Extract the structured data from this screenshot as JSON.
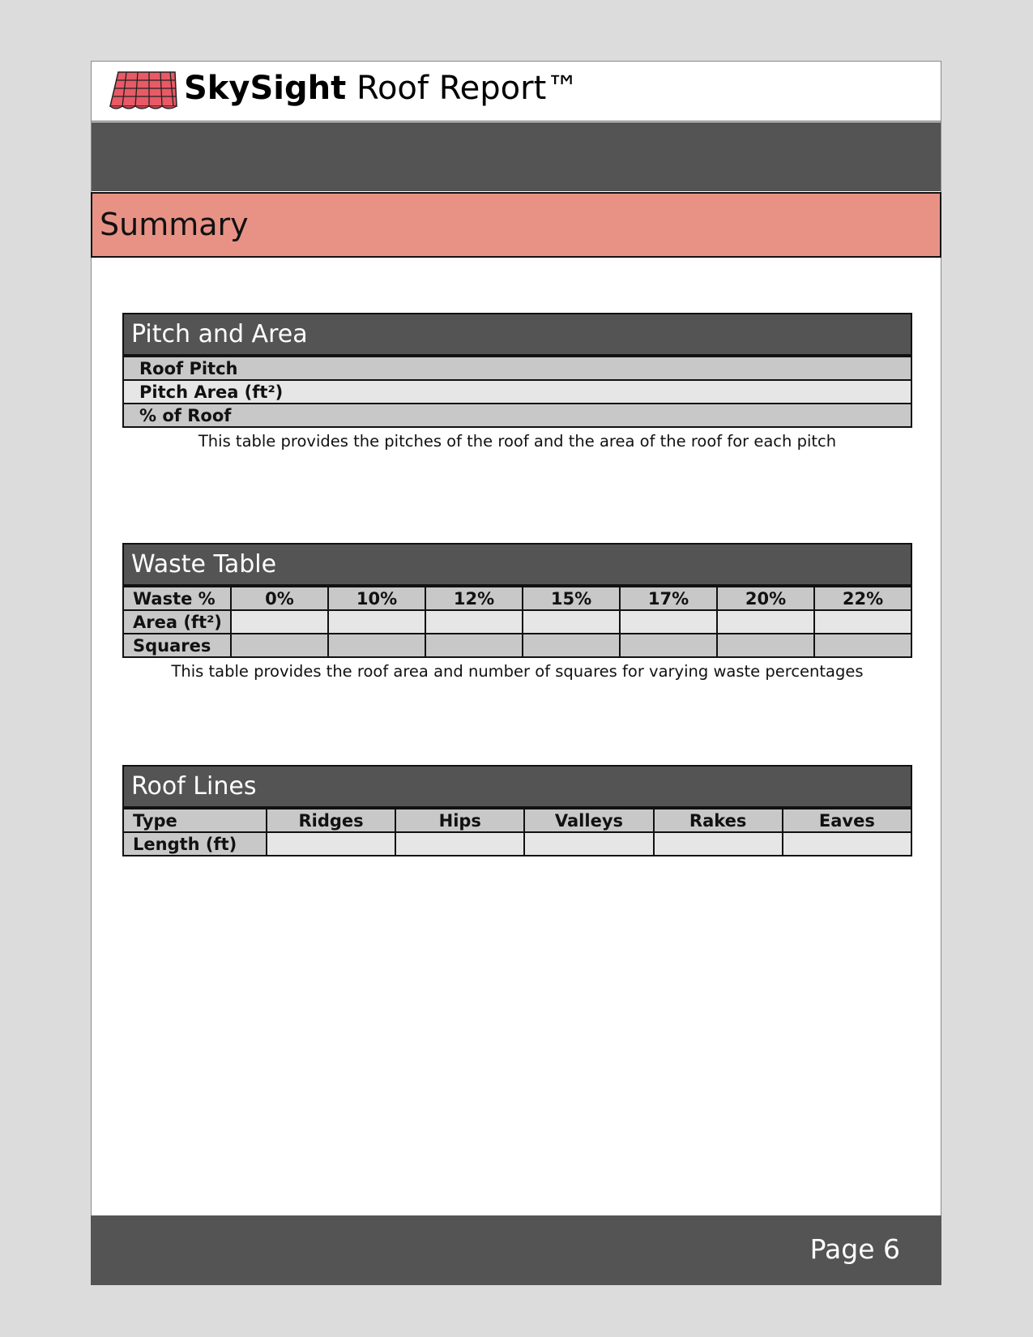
{
  "header": {
    "brand_bold": "SkySight",
    "brand_rest": " Roof Report™",
    "logo_icon": "roof-tiles-icon",
    "logo_color": "#e85a66"
  },
  "section": {
    "title": "Summary",
    "band_color": "#e89285"
  },
  "pitch_table": {
    "title": "Pitch and Area",
    "rows": [
      "Roof Pitch",
      "Pitch Area (ft²)",
      "% of Roof"
    ],
    "caption": "This table provides the pitches of the roof and the area of the roof for each pitch"
  },
  "waste_table": {
    "title": "Waste Table",
    "header_label": "Waste %",
    "columns": [
      "0%",
      "10%",
      "12%",
      "15%",
      "17%",
      "20%",
      "22%"
    ],
    "rows": [
      "Area (ft²)",
      "Squares"
    ],
    "caption": "This table provides the roof area and number of squares for varying waste percentages"
  },
  "lines_table": {
    "title": "Roof Lines",
    "header_label": "Type",
    "columns": [
      "Ridges",
      "Hips",
      "Valleys",
      "Rakes",
      "Eaves"
    ],
    "rows": [
      "Length (ft)"
    ]
  },
  "footer": {
    "page_label": "Page 6"
  },
  "colors": {
    "dark": "#545454",
    "cell_dark": "#c8c8c8",
    "cell_light": "#e6e6e6"
  }
}
